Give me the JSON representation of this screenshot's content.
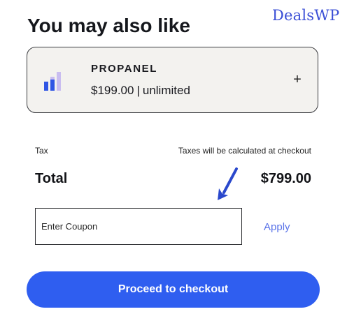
{
  "watermark": "DealsWP",
  "upsell": {
    "title": "You may also like",
    "product": {
      "icon": "bar-chart-icon",
      "name": "PROPANEL",
      "price": "$199.00",
      "separator": "|",
      "license": "unlimited",
      "add_icon": "plus-icon",
      "add_label": "+"
    }
  },
  "summary": {
    "tax_label": "Tax",
    "tax_value": "Taxes will be calculated at checkout",
    "total_label": "Total",
    "total_value": "$799.00"
  },
  "coupon": {
    "placeholder": "Enter Coupon",
    "apply_label": "Apply"
  },
  "checkout": {
    "button_label": "Proceed to checkout"
  },
  "colors": {
    "accent": "#2f5ef0",
    "link": "#5a73e8",
    "card_bg": "#f3f2ef",
    "arrow": "#2a48cc"
  }
}
